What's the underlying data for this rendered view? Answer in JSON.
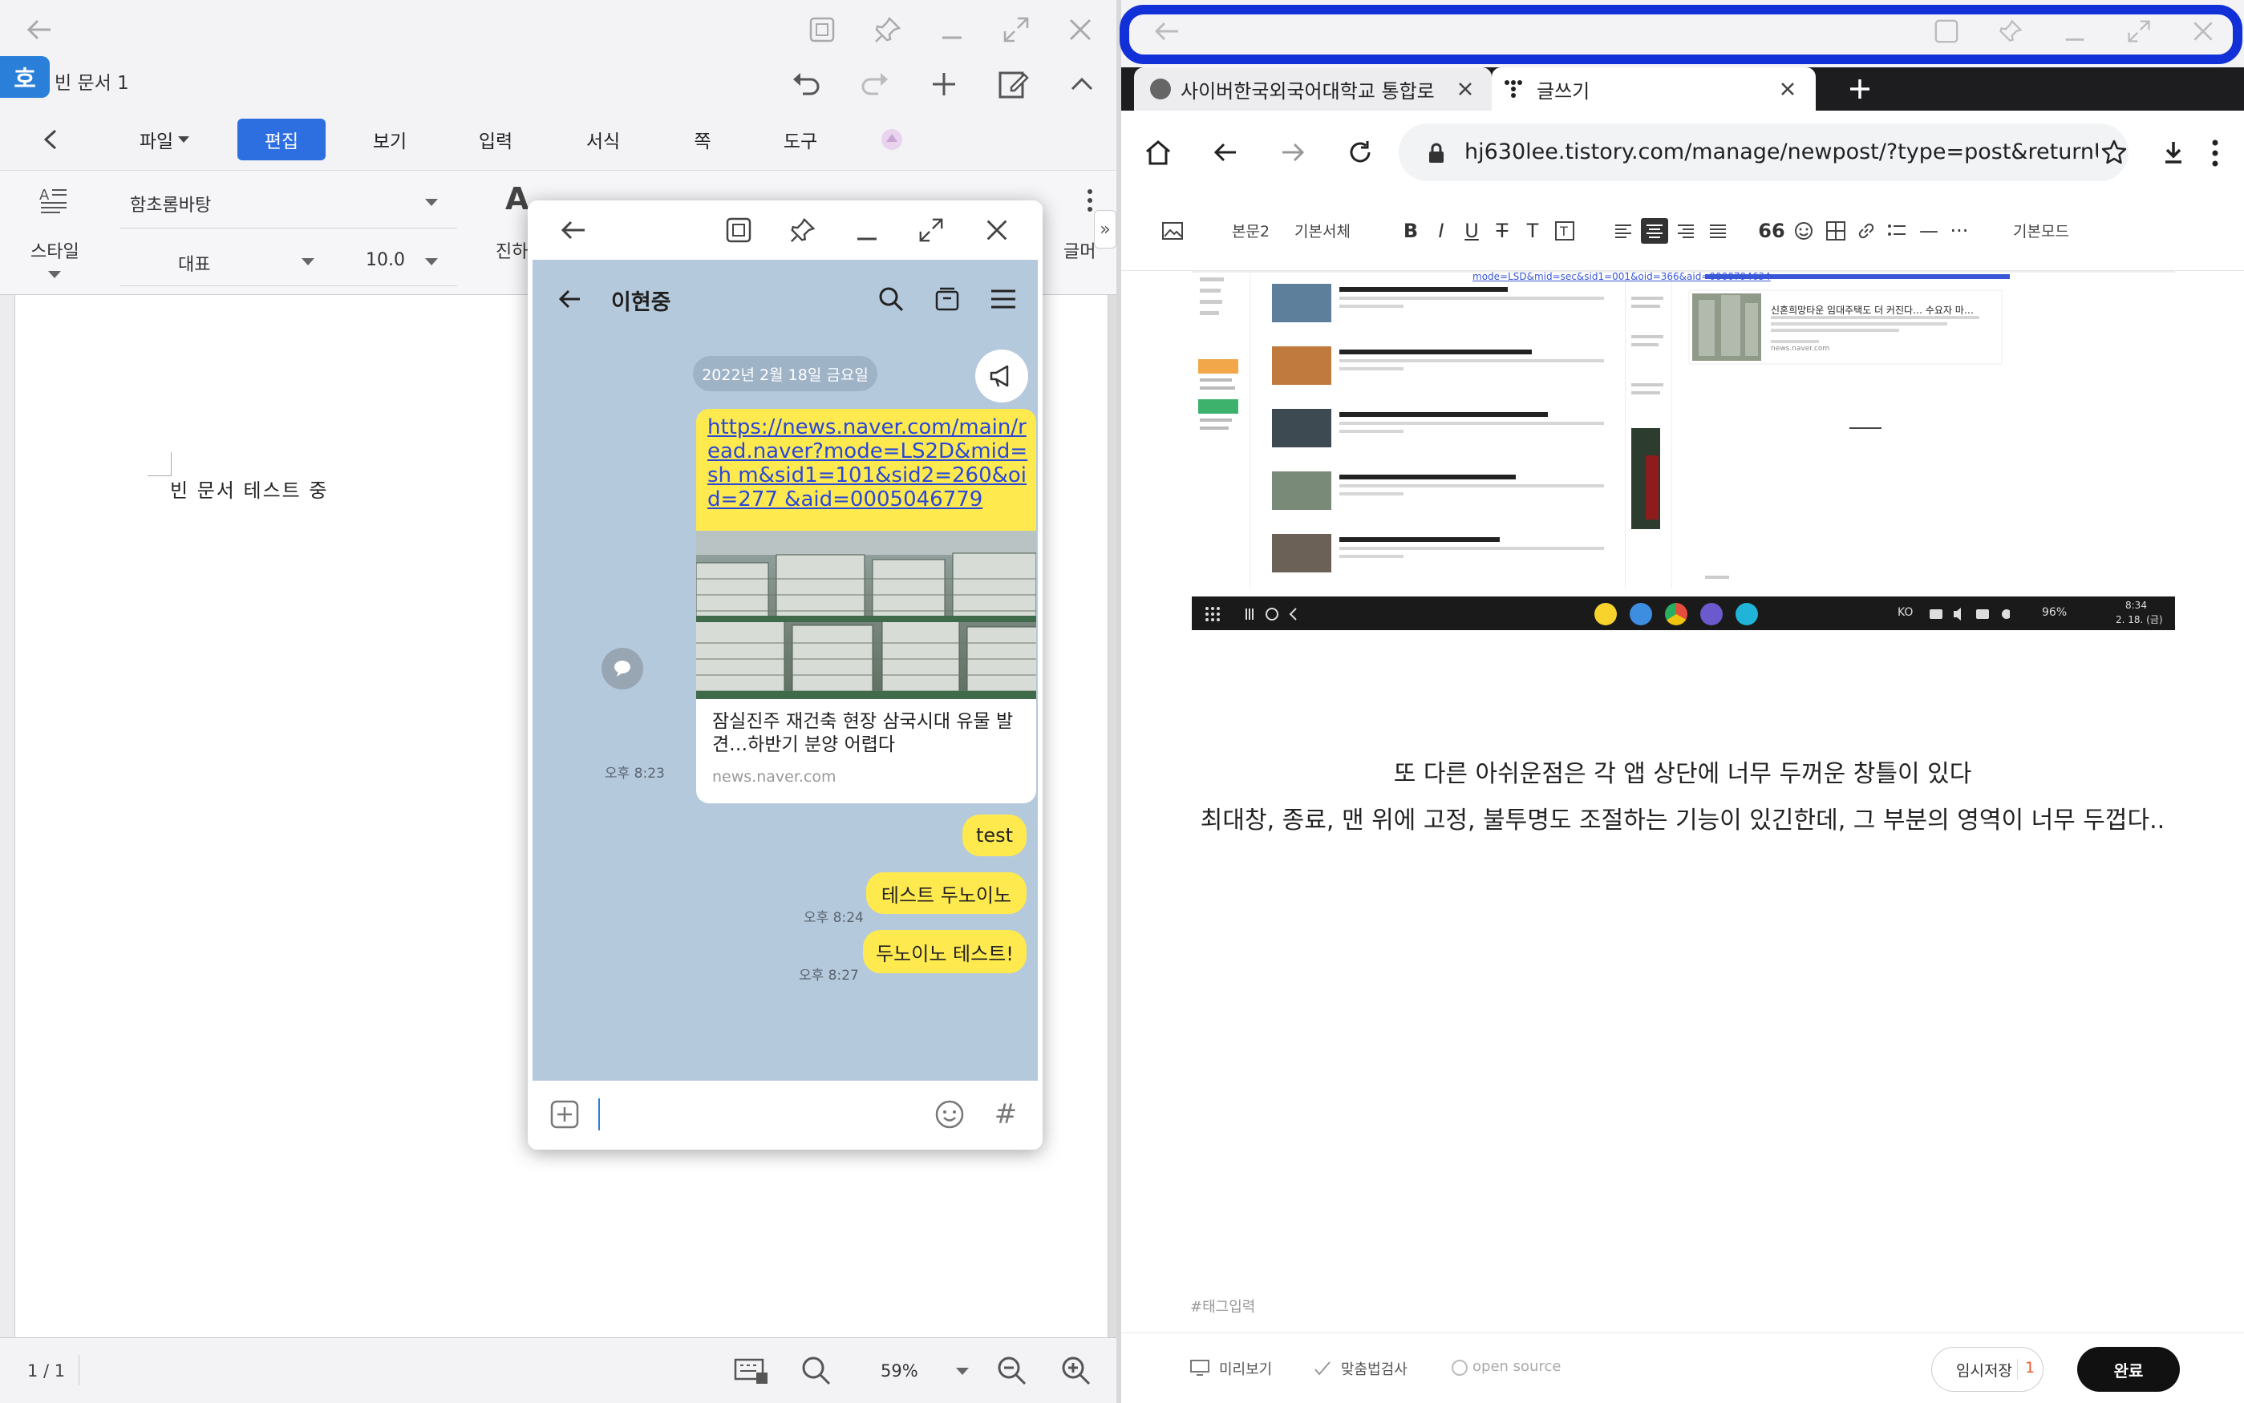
{
  "hwp": {
    "logo": "호",
    "doc_title": "빈 문서 1",
    "menu": [
      "파일",
      "편집",
      "보기",
      "입력",
      "서식",
      "쪽",
      "도구"
    ],
    "ribbon": {
      "style_label": "스타일",
      "font_name": "함초롬바탕",
      "para_style": "대표",
      "font_size": "10.0",
      "bold_label": "진하",
      "text_label": "글머"
    },
    "body_text": "빈 문서 테스트 중",
    "status": {
      "page": "1 / 1",
      "zoom": "59%"
    }
  },
  "kakao": {
    "contact": "이현중",
    "date": "2022년 2월 18일 금요일",
    "link_url": "https://news.naver.com/main/read.naver?mode=LS2D&mid=sh m&sid1=101&sid2=260&oid=277 &aid=0005046779",
    "preview_title": "잠실진주 재건축 현장 삼국시대 유물 발견…하반기 분양 어렵다",
    "preview_source": "news.naver.com",
    "messages": [
      {
        "text": "test",
        "time": "오후 8:23"
      },
      {
        "text": "테스트 두노이노",
        "time": "오후 8:24"
      },
      {
        "text": "두노이노 테스트!",
        "time": "오후 8:27"
      }
    ]
  },
  "browser": {
    "tabs": [
      {
        "label": "사이버한국외국어대학교 통합로"
      },
      {
        "label": "글쓰기"
      }
    ],
    "url": "hj630lee.tistory.com/manage/newpost/?type=post&returnURL",
    "editor_toolbar": {
      "paragraph": "본문2",
      "font": "기본서체",
      "mode": "기본모드"
    },
    "embedded": {
      "link_text": "mode=LSD&mid=sec&sid1=001&oid=366&aid=0000794634",
      "card_title": "신혼희망타운 임대주택도 더 커진다… 수요자 마…",
      "card_source": "news.naver.com",
      "taskbar_lang": "KO",
      "taskbar_battery": "96%",
      "taskbar_time": "8:34",
      "taskbar_date": "2. 18. (금)"
    },
    "para1": "또 다른 아쉬운점은 각 앱 상단에 너무 두꺼운 창틀이 있다",
    "para2": "최대창, 종료, 맨 위에 고정, 불투명도 조절하는 기능이 있긴한데, 그 부분의 영역이 너무 두껍다..",
    "tag_placeholder": "#태그입력",
    "footer": {
      "preview": "미리보기",
      "spellcheck": "맞춤법검사",
      "opensource": "open source",
      "temp_save": "임시저장",
      "temp_count": "1",
      "done": "완료"
    }
  },
  "colors": {
    "hwp_accent": "#2d6fe0",
    "kakao_bubble": "#fee94e",
    "kakao_bg": "#b5c9dc",
    "browser_highlight": "#1230d8"
  }
}
